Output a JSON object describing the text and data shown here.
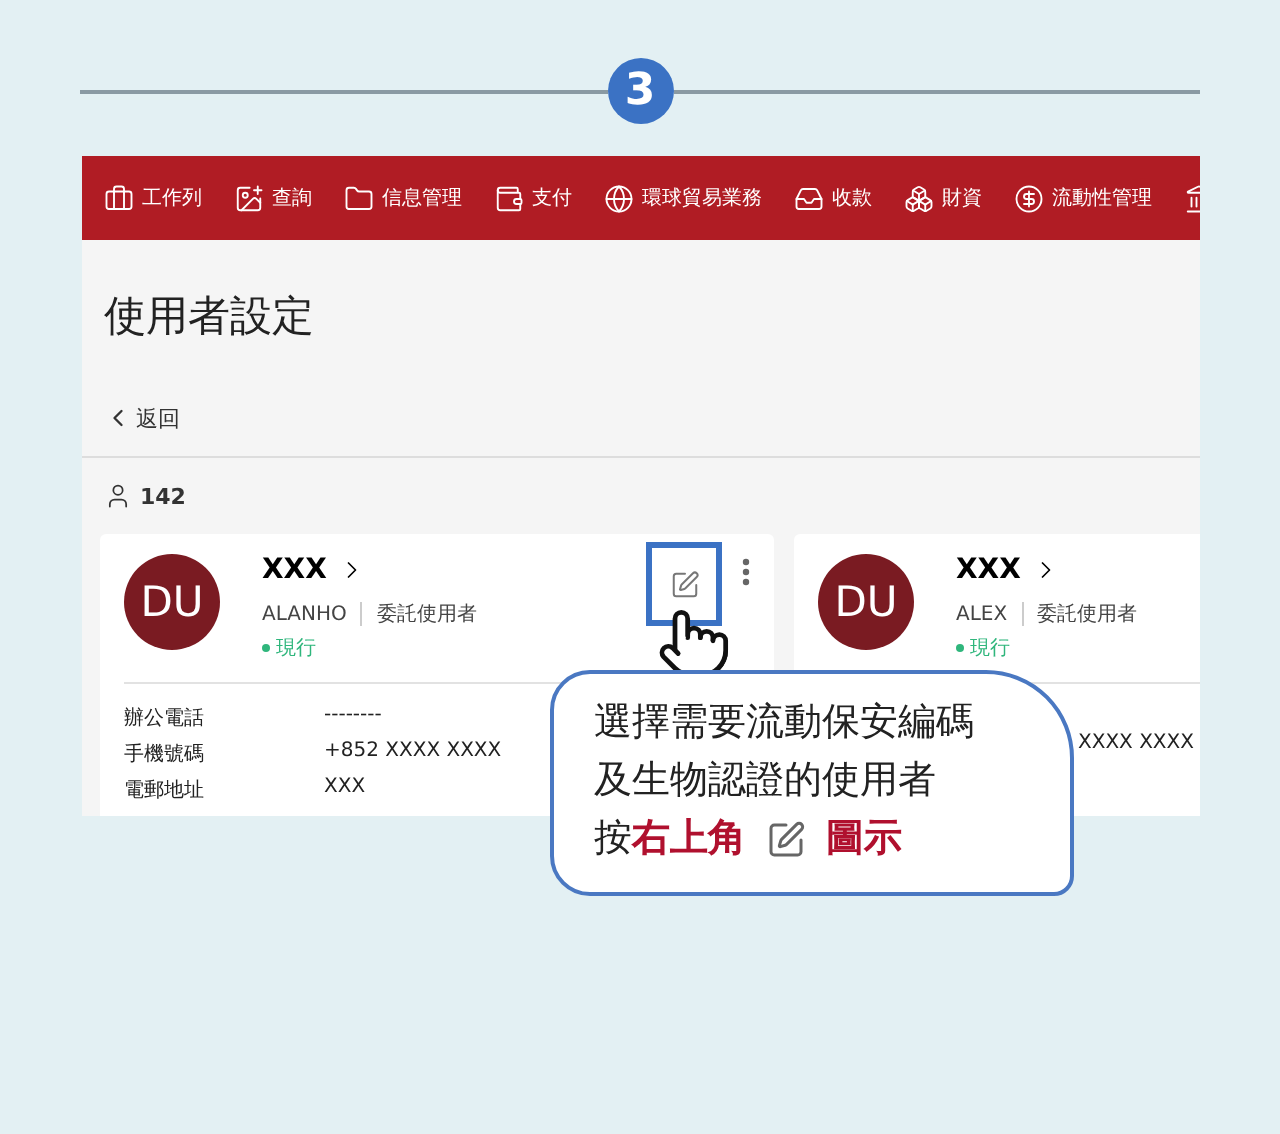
{
  "step": "3",
  "nav_items": [
    {
      "kind": "labeled",
      "label": "工作列"
    },
    {
      "kind": "labeled",
      "label": "查詢"
    },
    {
      "kind": "labeled",
      "label": "信息管理"
    },
    {
      "kind": "labeled",
      "label": "支付"
    },
    {
      "kind": "labeled",
      "label": "環球貿易業務"
    },
    {
      "kind": "labeled",
      "label": "收款"
    },
    {
      "kind": "labeled",
      "label": "財資"
    },
    {
      "kind": "labeled",
      "label": "流動性管理"
    },
    {
      "kind": "icon_only"
    }
  ],
  "page": {
    "title": "使用者設定",
    "back_label": "返回",
    "count": "142"
  },
  "users": [
    {
      "initials": "DU",
      "name": "XXX",
      "username": "ALANHO",
      "role": "委託使用者",
      "status": "現行",
      "edit_highlighted": true,
      "details": [
        {
          "kind": "full",
          "label": "辦公電話",
          "value": "--------"
        },
        {
          "kind": "full",
          "label": "手機號碼",
          "value": "+852 XXXX XXXX"
        },
        {
          "kind": "full",
          "label": "電郵地址",
          "value": "XXX"
        }
      ]
    },
    {
      "initials": "DU",
      "name": "XXX",
      "username": "ALEX",
      "role": "委託使用者",
      "status": "現行",
      "details": [
        {
          "kind": "partial",
          "value": "XXXX XXXX"
        }
      ]
    }
  ],
  "callout": {
    "lines": [
      [
        {
          "kind": "text",
          "text": "選擇需要流動保安編碼",
          "emphasis": false
        }
      ],
      [
        {
          "kind": "text",
          "text": "及生物認證的使用者",
          "emphasis": false
        }
      ],
      [
        {
          "kind": "text",
          "text": "按",
          "emphasis": false
        },
        {
          "kind": "text",
          "text": "右上角",
          "emphasis": true
        },
        {
          "kind": "icon"
        },
        {
          "kind": "text",
          "text": "圖示",
          "emphasis": true
        }
      ]
    ]
  }
}
